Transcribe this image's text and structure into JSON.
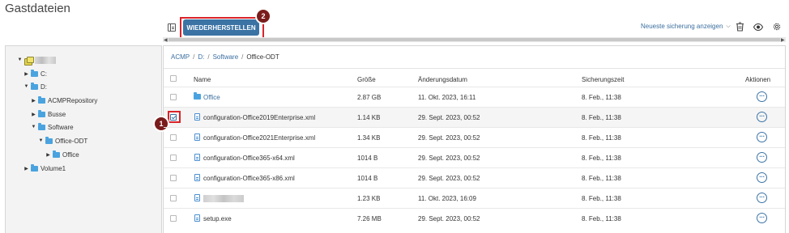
{
  "page": {
    "title": "Gastdateien"
  },
  "toolbar": {
    "restore_label": "WIEDERHERSTELLEN",
    "backup_select_label": "Neueste sicherung anzeigen",
    "icons": [
      "panel-toggle-icon",
      "trash-clock-icon",
      "eye-icon",
      "gear-icon"
    ]
  },
  "annotations": {
    "step1": "1",
    "step2": "2"
  },
  "breadcrumb": [
    {
      "label": "ACMP",
      "link": true
    },
    {
      "label": "D:",
      "link": true
    },
    {
      "label": "Software",
      "link": true
    },
    {
      "label": "Office-ODT",
      "link": false
    }
  ],
  "tree": {
    "root_label": "",
    "items": [
      {
        "label": "C:",
        "expanded": false
      },
      {
        "label": "D:",
        "expanded": true
      },
      {
        "label": "ACMPRepository",
        "expanded": false
      },
      {
        "label": "Busse",
        "expanded": false
      },
      {
        "label": "Software",
        "expanded": true
      },
      {
        "label": "Office-ODT",
        "expanded": true
      },
      {
        "label": "Office",
        "expanded": false
      },
      {
        "label": "Volume1",
        "expanded": false
      }
    ]
  },
  "table": {
    "columns": {
      "name": "Name",
      "size": "Größe",
      "modified": "Änderungsdatum",
      "backup": "Sicherungszeit",
      "actions": "Aktionen"
    },
    "rows": [
      {
        "name": "Office",
        "type": "folder",
        "size": "2.87 GB",
        "modified": "11. Okt. 2023, 16:11",
        "backup": "8. Feb., 11:38",
        "checked": false
      },
      {
        "name": "configuration-Office2019Enterprise.xml",
        "type": "file",
        "size": "1.14 KB",
        "modified": "29. Sept. 2023, 00:52",
        "backup": "8. Feb., 11:38",
        "checked": true
      },
      {
        "name": "configuration-Office2021Enterprise.xml",
        "type": "file",
        "size": "1.34 KB",
        "modified": "29. Sept. 2023, 00:52",
        "backup": "8. Feb., 11:38",
        "checked": false
      },
      {
        "name": "configuration-Office365-x64.xml",
        "type": "file",
        "size": "1014 B",
        "modified": "29. Sept. 2023, 00:52",
        "backup": "8. Feb., 11:38",
        "checked": false
      },
      {
        "name": "configuration-Office365-x86.xml",
        "type": "file",
        "size": "1014 B",
        "modified": "29. Sept. 2023, 00:52",
        "backup": "8. Feb., 11:38",
        "checked": false
      },
      {
        "name": "",
        "type": "file",
        "size": "1.23 KB",
        "modified": "11. Okt. 2023, 16:09",
        "backup": "8. Feb., 11:38",
        "checked": false
      },
      {
        "name": "setup.exe",
        "type": "file",
        "size": "7.26 MB",
        "modified": "29. Sept. 2023, 00:52",
        "backup": "8. Feb., 11:38",
        "checked": false
      }
    ],
    "action_glyph": "···"
  }
}
